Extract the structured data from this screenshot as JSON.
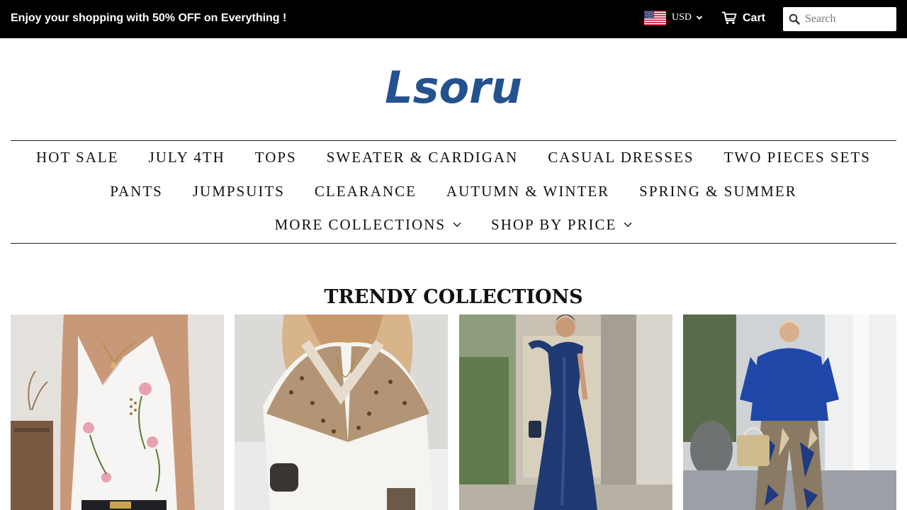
{
  "announcement": "Enjoy your shopping with 50% OFF on Everything !",
  "currency": {
    "code": "USD",
    "flag": "us-flag-icon"
  },
  "cart": {
    "label": "Cart",
    "icon": "cart-icon"
  },
  "search": {
    "placeholder": "Search",
    "icon": "search-icon"
  },
  "logo": {
    "text": "Lsoru",
    "color": "#24528f"
  },
  "nav": {
    "row1": [
      "HOT SALE",
      "JULY 4TH",
      "TOPS",
      "SWEATER & CARDIGAN",
      "CASUAL DRESSES",
      "TWO PIECES SETS"
    ],
    "row2": [
      "PANTS",
      "JUMPSUITS",
      "CLEARANCE",
      "AUTUMN & WINTER",
      "SPRING & SUMMER"
    ],
    "row3": [
      "MORE COLLECTIONS",
      "SHOP BY PRICE"
    ]
  },
  "section": {
    "title": "TRENDY COLLECTIONS"
  },
  "collections": [
    {
      "image": "floral sleeveless v-neck top"
    },
    {
      "image": "leopard v-neck knit sweater"
    },
    {
      "image": "navy one-shoulder satin dress"
    },
    {
      "image": "blue top with printed pants set"
    }
  ],
  "colors": {
    "topbar": "#000000",
    "brand": "#24528f",
    "text": "#111111"
  }
}
